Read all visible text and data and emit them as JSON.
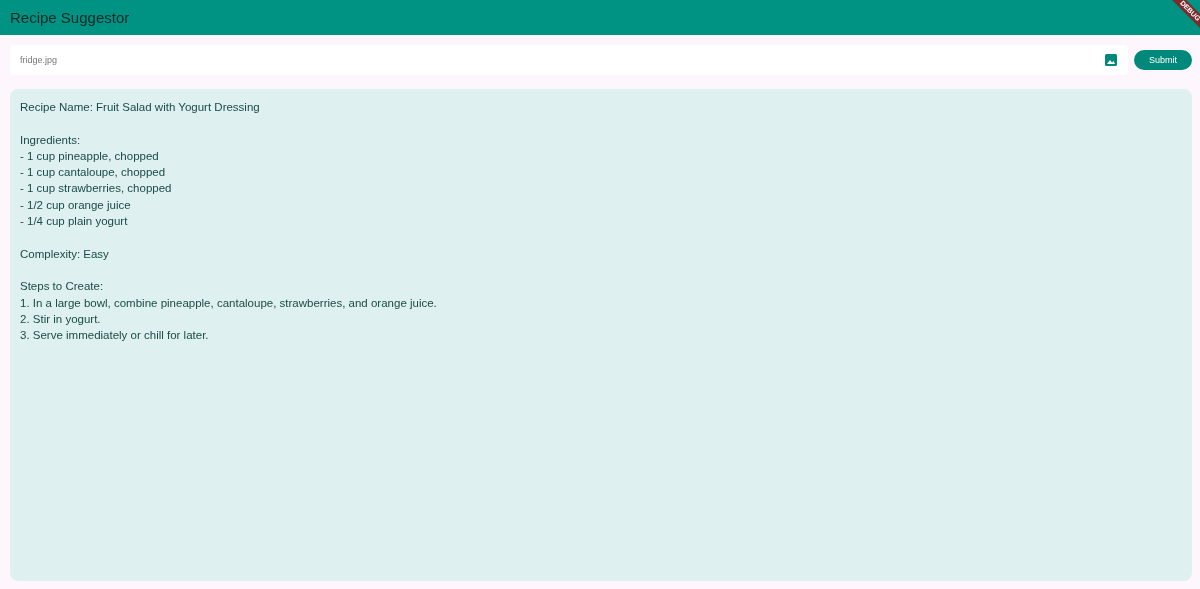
{
  "app_bar": {
    "title": "Recipe Suggestor",
    "debug_banner": "DEBUG"
  },
  "input": {
    "value": "fridge.jpg",
    "submit_label": "Submit"
  },
  "result": {
    "sections": [
      [
        "Recipe Name: Fruit Salad with Yogurt Dressing"
      ],
      [
        "Ingredients:",
        "- 1 cup pineapple, chopped",
        "- 1 cup cantaloupe, chopped",
        "- 1 cup strawberries, chopped",
        "- 1/2 cup orange juice",
        "- 1/4 cup plain yogurt"
      ],
      [
        "Complexity: Easy"
      ],
      [
        "Steps to Create:",
        "1. In a large bowl, combine pineapple, cantaloupe, strawberries, and orange juice.",
        "2. Stir in yogurt.",
        "3. Serve immediately or chill for later."
      ]
    ]
  }
}
